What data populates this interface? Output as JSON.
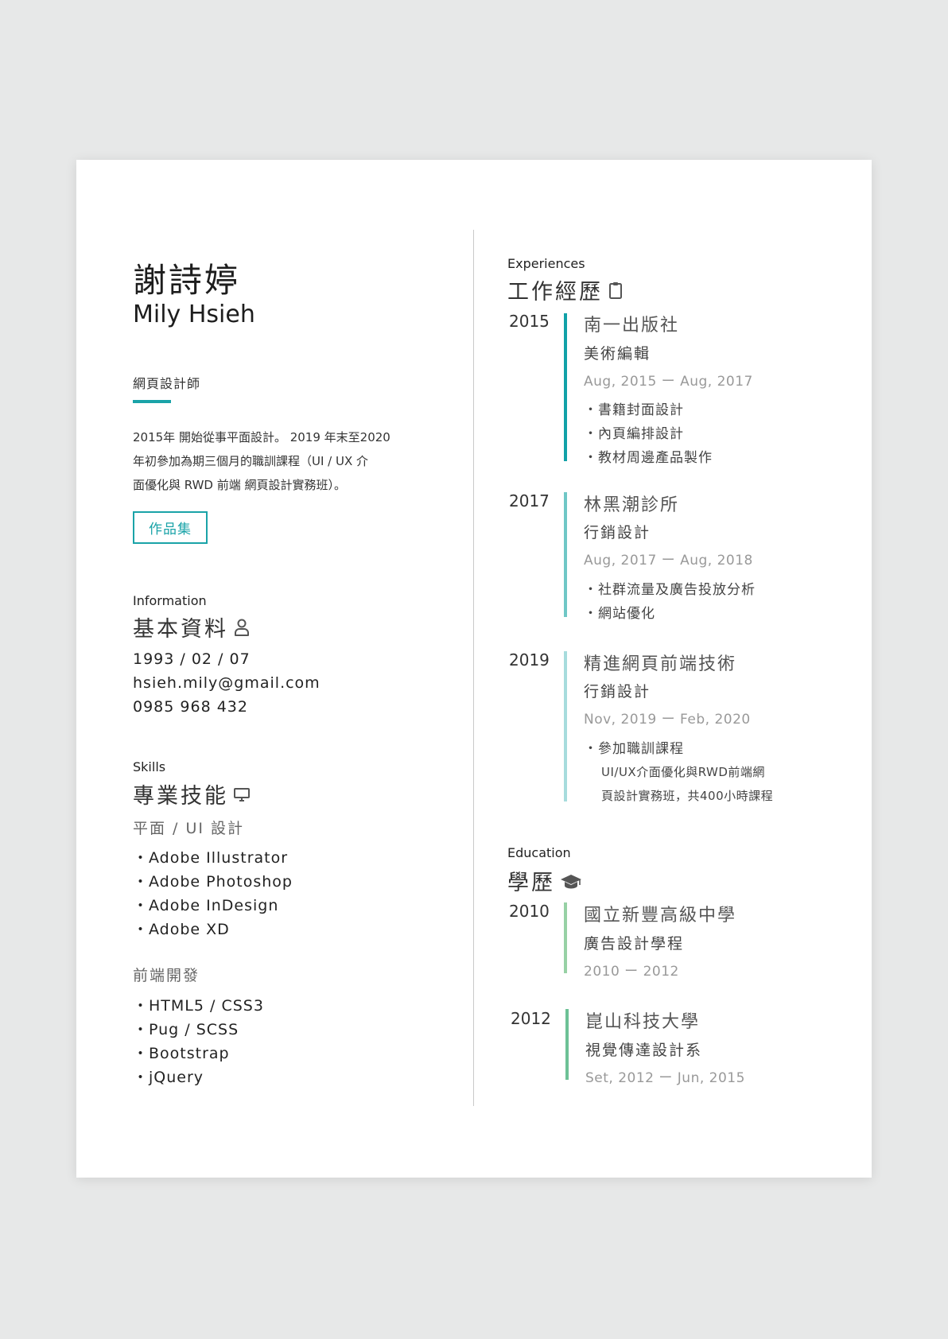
{
  "profile": {
    "name_zh": "謝詩婷",
    "name_en": "Mily Hsieh",
    "job_title": "網頁設計師",
    "intro_lines": [
      "2015年 開始從事平面設計。 2019 年末至2020",
      "年初參加為期三個月的職訓課程（UI /  UX 介",
      "面優化與 RWD 前端 網頁設計實務班）。"
    ],
    "portfolio_label": "作品集"
  },
  "information": {
    "heading_en": "Information",
    "heading_zh": "基本資料",
    "icon": "user-icon",
    "birthday": "1993 / 02 / 07",
    "email": "hsieh.mily@gmail.com",
    "phone": "0985 968 432"
  },
  "skills": {
    "heading_en": "Skills",
    "heading_zh": "專業技能",
    "icon": "monitor-icon",
    "groups": [
      {
        "title": "平面 / UI 設計",
        "items": [
          "・Adobe Illustrator",
          "・Adobe Photoshop",
          "・Adobe InDesign",
          "・Adobe XD"
        ]
      },
      {
        "title": "前端開發",
        "items": [
          "・HTML5 / CSS3",
          "・Pug / SCSS",
          "・Bootstrap",
          "・jQuery"
        ]
      }
    ]
  },
  "experiences": {
    "heading_en": "Experiences",
    "heading_zh": "工作經歷",
    "icon": "clipboard-icon",
    "items": [
      {
        "year": "2015",
        "org": "南一出版社",
        "role": "美術編輯",
        "date": "Aug, 2015  ー  Aug, 2017",
        "color": "#11a1a8",
        "bullets": [
          "・書籍封面設計",
          "・內頁編排設計",
          "・教材周邊產品製作"
        ]
      },
      {
        "year": "2017",
        "org": "林黑潮診所",
        "role": "行銷設計",
        "date": "Aug, 2017  ー  Aug, 2018",
        "color": "#6fc7c6",
        "bullets": [
          "・社群流量及廣告投放分析",
          "・網站優化"
        ]
      },
      {
        "year": "2019",
        "org": "精進網頁前端技術",
        "role": "行銷設計",
        "date": "Nov, 2019  ー  Feb, 2020",
        "color": "#a7dcdd",
        "bullets": [
          "・參加職訓課程"
        ],
        "sub_lines": [
          "UI/UX介面優化與RWD前端網",
          "頁設計實務班，共400小時課程"
        ]
      }
    ]
  },
  "education": {
    "heading_en": "Education",
    "heading_zh": "學歷",
    "icon": "graduation-cap-icon",
    "items": [
      {
        "year": "2010",
        "school": "國立新豐高級中學",
        "dept": "廣告設計學程",
        "date": "2010  ー  2012",
        "color": "#97d1a5"
      },
      {
        "year": "2012",
        "school": "崑山科技大學",
        "dept": "視覺傳達設計系",
        "date": "Set, 2012  ー  Jun, 2015",
        "color": "#6dc196"
      }
    ]
  }
}
